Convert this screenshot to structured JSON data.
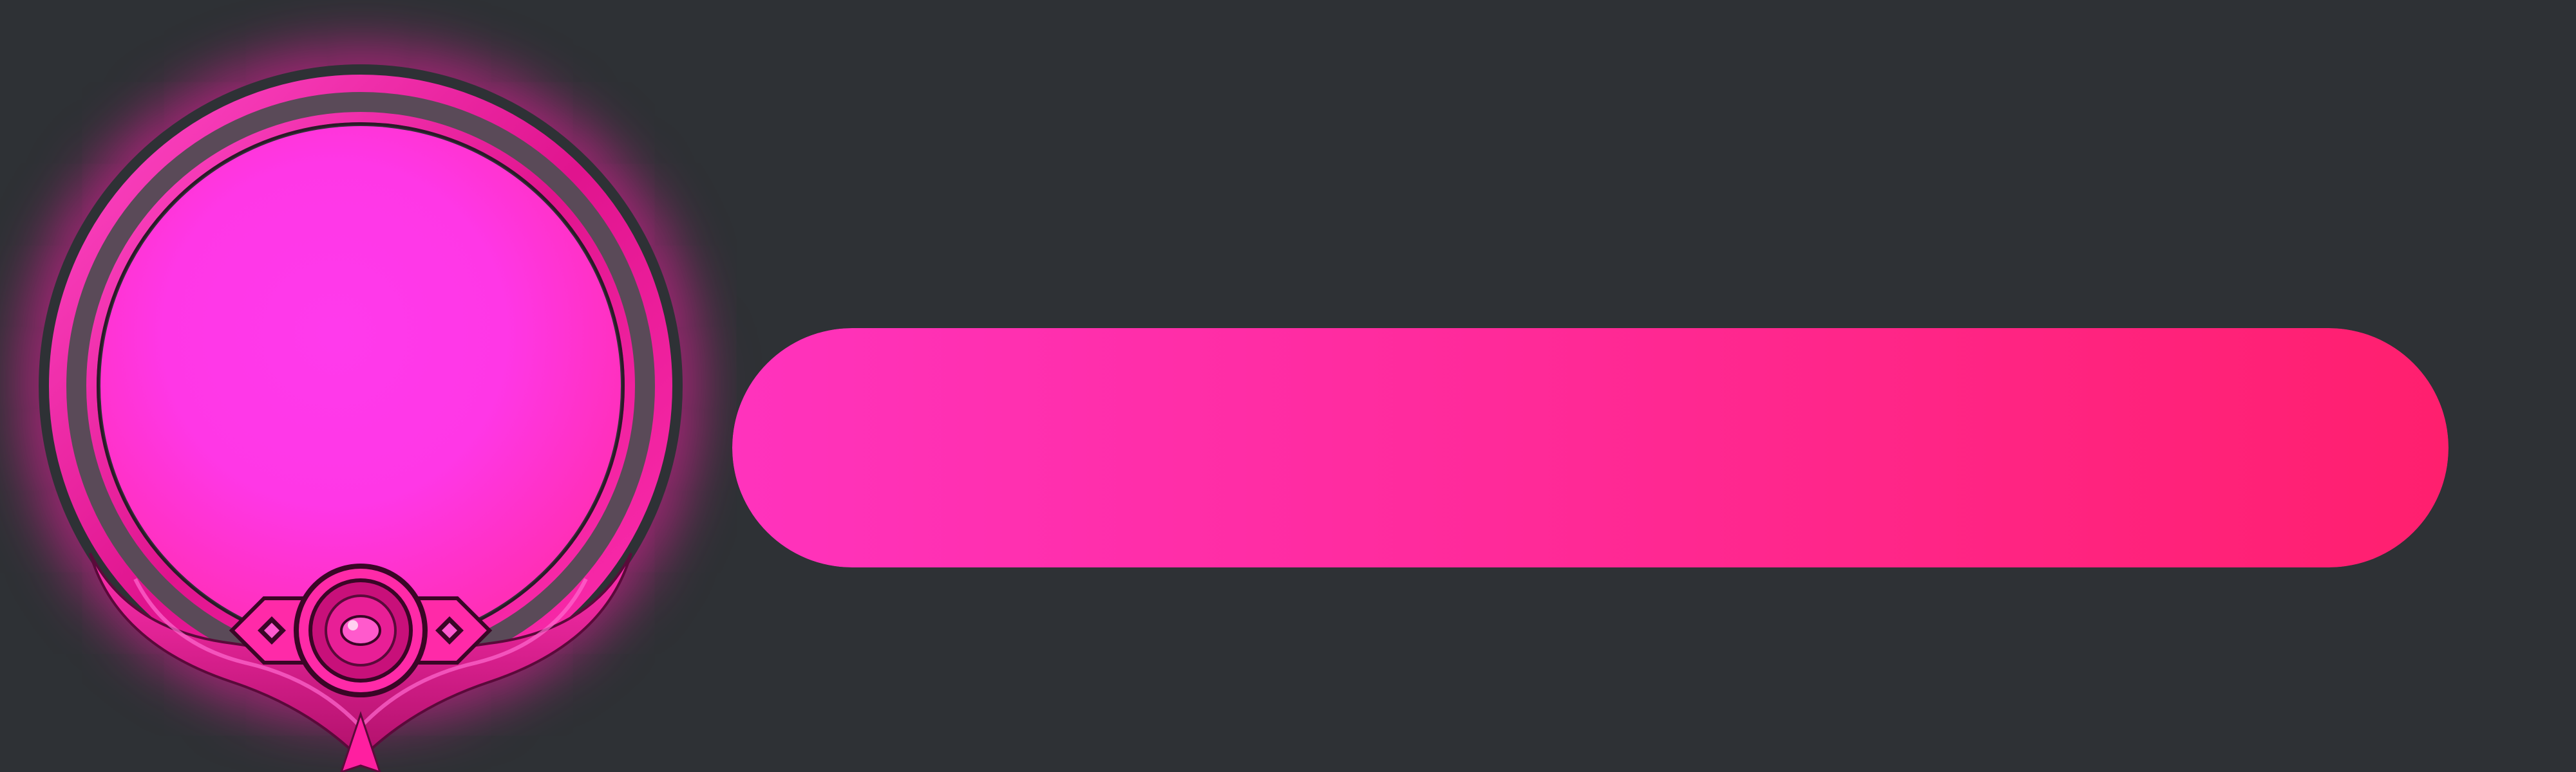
{
  "avatar": {
    "icon": "profile-frame-icon",
    "portrait_color": "#ff3aec",
    "ring_color": "#ff1fb0",
    "gem_icon": "eye-gem-icon"
  },
  "progress": {
    "fraction": 1.0,
    "color_start": "#ff33bd",
    "color_end": "#ff1f6e"
  }
}
